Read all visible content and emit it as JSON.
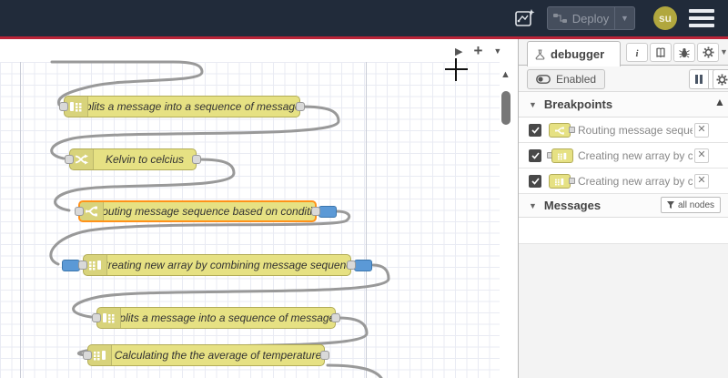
{
  "header": {
    "deploy": {
      "label": "Deploy"
    },
    "avatar": {
      "text": "su"
    },
    "colors": {
      "bar": "#212b3a",
      "accent_line": "#bb2438"
    }
  },
  "canvas": {
    "colors": {
      "node_fill": "#e6e183",
      "node_border": "#b2ac58",
      "selected_border": "#ff9219",
      "breakpoint_fill": "#5b99d6",
      "wire": "#999999"
    },
    "nodes": [
      {
        "label": "Splits a message into a sequence of messages.",
        "type": "split"
      },
      {
        "label": "Kelvin to celcius",
        "type": "change"
      },
      {
        "label": "Routing message sequence based on condition",
        "type": "switch",
        "selected": true,
        "breakpoint_ports": [
          "output"
        ]
      },
      {
        "label": "Creating new array by combining message sequence",
        "type": "join",
        "breakpoint_ports": [
          "input",
          "output"
        ]
      },
      {
        "label": "Splits a message into a sequence of messages.",
        "type": "split"
      },
      {
        "label": "Calculating the the average of temperature",
        "type": "join"
      }
    ]
  },
  "sidebar": {
    "tab": {
      "label": "debugger"
    },
    "toolbar": {
      "enabled_label": "Enabled"
    },
    "breakpoints": {
      "title": "Breakpoints",
      "items": [
        {
          "label": "Routing message sequence ba",
          "checked": true
        },
        {
          "label": "Creating new array by combini",
          "checked": true
        },
        {
          "label": "Creating new array by combini",
          "checked": true
        }
      ]
    },
    "messages": {
      "title": "Messages",
      "filter_label": "all nodes"
    }
  }
}
